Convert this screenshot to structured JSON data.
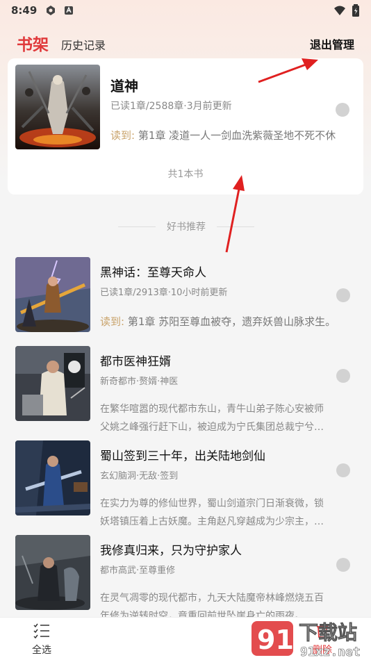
{
  "status_bar": {
    "time": "8:49"
  },
  "header": {
    "tab_active": "书架",
    "tab_history": "历史记录",
    "exit_manage": "退出管理"
  },
  "shelf": {
    "book": {
      "title": "道神",
      "meta": "已读1章/2588章·3月前更新",
      "read_label": "读到:",
      "read_chapter": "第1章 凌道一人一剑血洗紫薇圣地不死不休"
    },
    "count_text": "共1本书"
  },
  "recommend": {
    "heading": "好书推荐",
    "items": [
      {
        "title": "黑神话：至尊天命人",
        "meta": "已读1章/2913章·10小时前更新",
        "read_label": "读到:",
        "desc": [
          "第1章 苏阳至尊血被夺，遗弃妖兽山脉求生。"
        ]
      },
      {
        "title": "都市医神狂婿",
        "meta": "新奇都市·赘婿·神医",
        "desc": [
          "在繁华喧嚣的现代都市东山，青牛山弟子陈心安被师",
          "父姚之峰强行赶下山，被迫成为宁氏集团总裁宁兮…"
        ]
      },
      {
        "title": "蜀山签到三十年，出关陆地剑仙",
        "meta": "玄幻脑洞·无敌·签到",
        "desc": [
          "在实力为尊的修仙世界，蜀山剑道宗门日渐衰微，锁",
          "妖塔镇压着上古妖魔。主角赵凡穿越成为少宗主，…"
        ]
      },
      {
        "title": "我修真归来，只为守护家人",
        "meta": "都市高武·至尊重修",
        "desc": [
          "在灵气凋零的现代都市，九天大陆魔帝林峰燃烧五百",
          "年修为逆转时空，竟重回前世坠崖身亡的雨夜。…"
        ]
      }
    ]
  },
  "bottom_bar": {
    "select_all": "全选",
    "delete": "删除"
  },
  "watermark": {
    "brand": "下载站",
    "domain": "91xz.net"
  },
  "colors": {
    "accent": "#e0393b",
    "read_label": "#c9a36b",
    "annotation_arrow": "#e02020"
  }
}
